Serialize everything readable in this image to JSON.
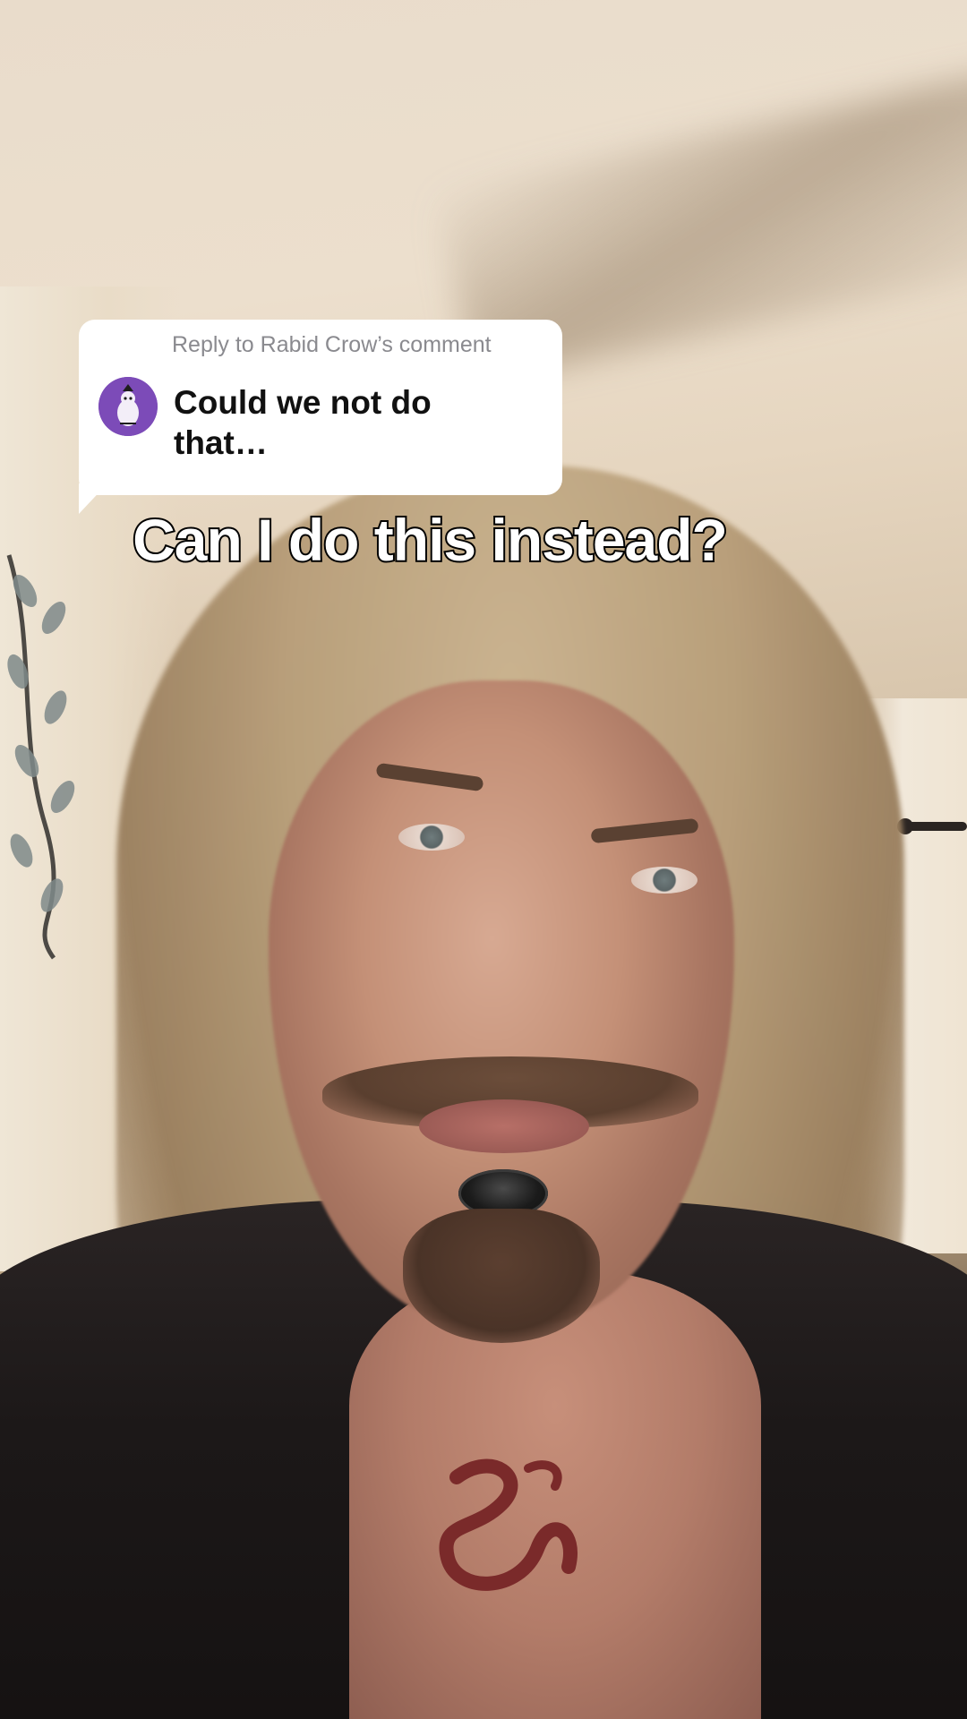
{
  "reply": {
    "header": "Reply to Rabid Crow’s comment",
    "comment": "Could we not do that…",
    "avatar_icon": "crow-avatar-icon",
    "avatar_color": "#7c4bb8"
  },
  "caption": {
    "text": "Can I do this instead?"
  }
}
